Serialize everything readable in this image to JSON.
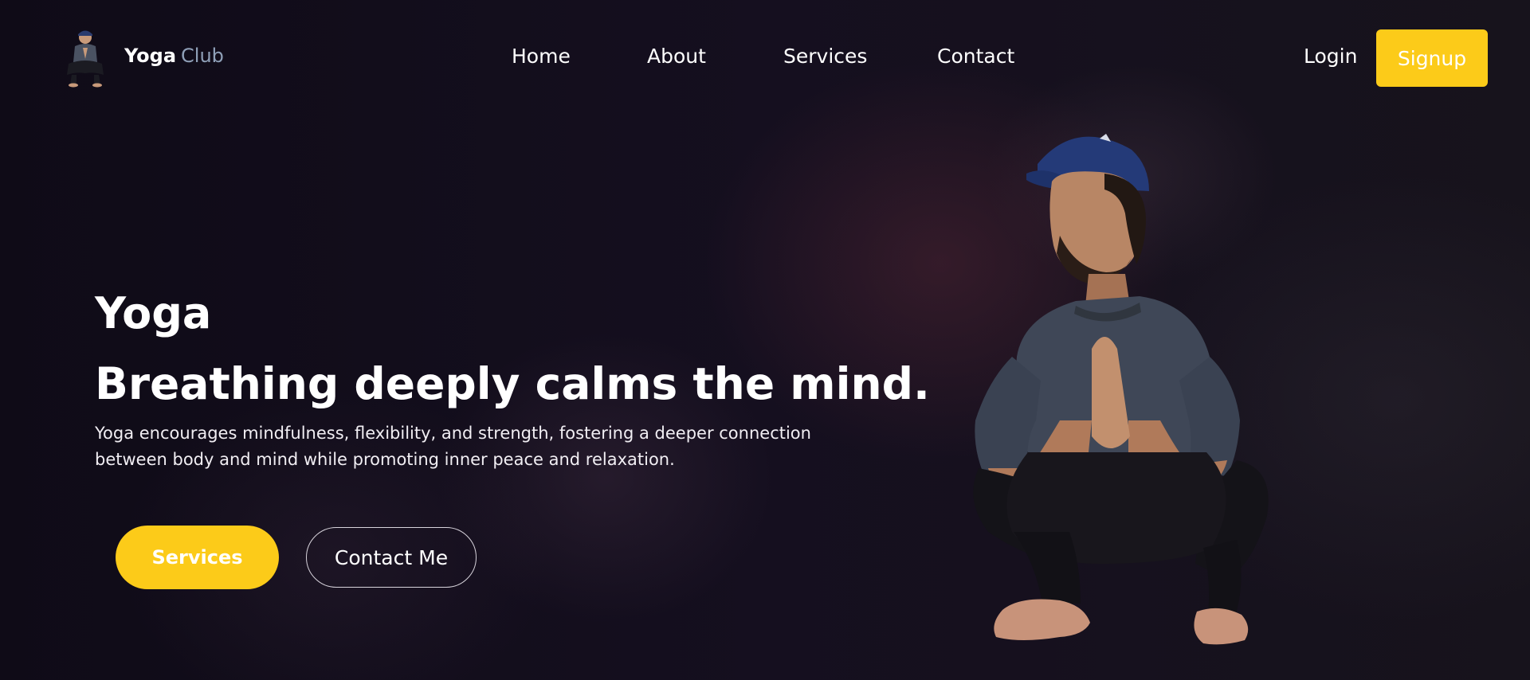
{
  "brand": {
    "name_bold": "Yoga",
    "name_light": "Club",
    "logo": "yoga-pose-logo"
  },
  "nav": {
    "items": [
      {
        "label": "Home"
      },
      {
        "label": "About"
      },
      {
        "label": "Services"
      },
      {
        "label": "Contact"
      }
    ],
    "login_label": "Login",
    "signup_label": "Signup"
  },
  "hero": {
    "kicker": "Yoga",
    "title": "Breathing deeply calms the mind.",
    "description": "Yoga encourages mindfulness, flexibility, and strength, fostering a deeper connection between body and mind while promoting inner peace and relaxation.",
    "primary_button": "Services",
    "secondary_button": "Contact Me",
    "image": "man-in-squat-namaste-pose"
  },
  "colors": {
    "accent": "#fccb19",
    "background": "#120d1a",
    "brand_light": "#8fa0b8"
  }
}
